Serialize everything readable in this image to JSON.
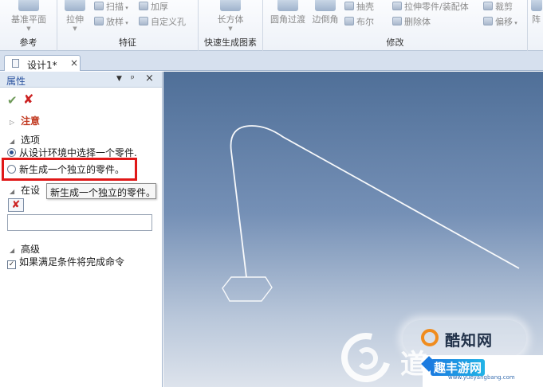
{
  "ribbon": {
    "groups": [
      {
        "title": "参考",
        "buttons": [
          "基准平面"
        ]
      },
      {
        "title": "特征",
        "big": [
          "拉伸"
        ],
        "small": [
          "扫描",
          "加厚",
          "放样",
          "自定义孔"
        ]
      },
      {
        "title": "快速生成图素",
        "big": [
          "长方体"
        ]
      },
      {
        "title": "修改",
        "big": [
          "圆角过渡",
          "边倒角"
        ],
        "small": [
          "抽壳",
          "拉伸零件/装配体",
          "裁剪",
          "布尔",
          "删除体",
          "偏移"
        ]
      },
      {
        "title": "",
        "big": [
          "阵"
        ]
      }
    ]
  },
  "document_tabs": [
    {
      "label": "设计1*",
      "close": "×"
    }
  ],
  "properties_panel": {
    "title": "属性",
    "header_buttons": {
      "menu": "▼",
      "pin": "ᵖ",
      "close": "×"
    },
    "actions": {
      "ok": "✔",
      "cancel": "✘"
    },
    "notice": {
      "label": "注意"
    },
    "options": {
      "label": "选项",
      "choices": [
        {
          "label": "从设计环境中选择一个零件.",
          "selected": true
        },
        {
          "label": "新生成一个独立的零件。",
          "selected": false
        }
      ]
    },
    "in_design": {
      "label": "在设",
      "delete_button": "✘",
      "field_value": ""
    },
    "tooltip": "新生成一个独立的零件。",
    "advanced": {
      "label": "高级",
      "checkbox": {
        "label": "如果满足条件将完成命令",
        "checked": true
      }
    }
  },
  "watermarks": {
    "cool_site": "酷知网",
    "big_chars": "道",
    "site_name": "趣丰游网",
    "site_url": "www.yueyangbang.com"
  },
  "colors": {
    "highlight": "#e01818",
    "panel_title": "#2d55a0",
    "viewport_top": "#4f6f98",
    "viewport_bottom": "#dde3ec",
    "sketch_line": "#ffffff"
  }
}
